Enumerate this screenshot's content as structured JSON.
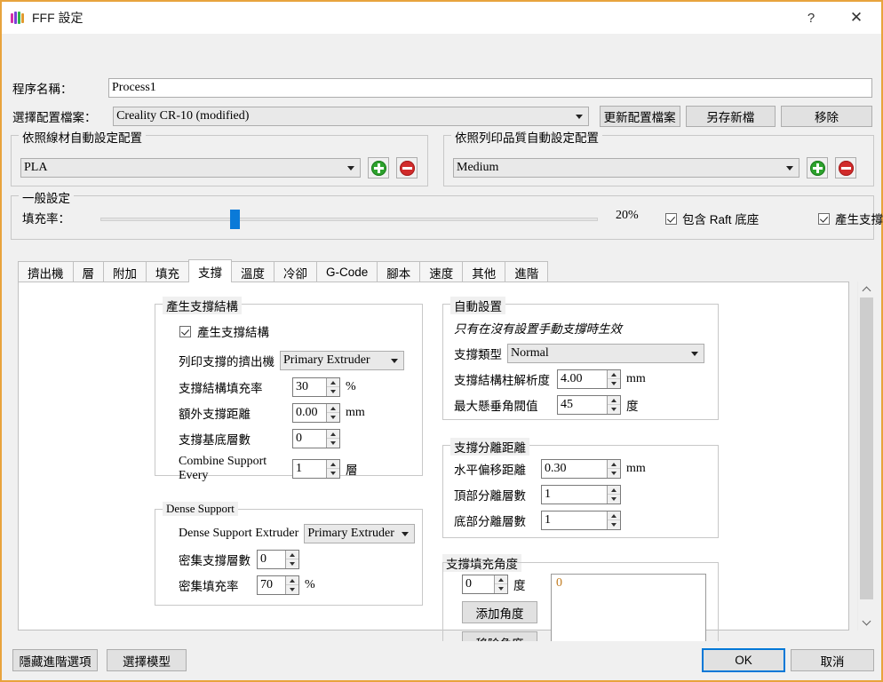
{
  "window": {
    "title": "FFF 設定",
    "icon": "app-logo-icon",
    "help_label": "?",
    "close_label": "✕",
    "accent_color": "#e8a33d"
  },
  "header": {
    "process_name_label": "程序名稱：",
    "process_name_value": "Process1",
    "profile_label": "選擇配置檔案：",
    "profile_value": "Creality CR-10 (modified)",
    "update_profile_button": "更新配置檔案",
    "save_as_button": "另存新檔",
    "remove_button": "移除"
  },
  "material_group": {
    "title": "依照線材自動設定配置",
    "value": "PLA",
    "add_button": "add-icon",
    "remove_button": "remove-icon"
  },
  "quality_group": {
    "title": "依照列印品質自動設定配置",
    "value": "Medium",
    "add_button": "add-icon",
    "remove_button": "remove-icon"
  },
  "general_group": {
    "title": "一般設定",
    "infill_label": "填充率：",
    "infill_value": "20%",
    "infill_percent": 20,
    "raft_checkbox_label": "包含 Raft 底座",
    "raft_checked": true,
    "support_checkbox_label": "產生支撐",
    "support_checked": true
  },
  "tabs": [
    {
      "label": "擠出機",
      "active": false
    },
    {
      "label": "層",
      "active": false
    },
    {
      "label": "附加",
      "active": false
    },
    {
      "label": "填充",
      "active": false
    },
    {
      "label": "支撐",
      "active": true
    },
    {
      "label": "溫度",
      "active": false
    },
    {
      "label": "冷卻",
      "active": false
    },
    {
      "label": "G-Code",
      "active": false
    },
    {
      "label": "腳本",
      "active": false
    },
    {
      "label": "速度",
      "active": false
    },
    {
      "label": "其他",
      "active": false
    },
    {
      "label": "進階",
      "active": false
    }
  ],
  "support_structure_group": {
    "title": "產生支撐結構",
    "enable_label": "產生支撐結構",
    "enable_checked": true,
    "extruder_label": "列印支撐的擠出機",
    "extruder_value": "Primary Extruder",
    "infill_label": "支撐結構填充率",
    "infill_value": "30",
    "infill_unit": "%",
    "extra_distance_label": "額外支撐距離",
    "extra_distance_value": "0.00",
    "extra_distance_unit": "mm",
    "base_layers_label": "支撐基底層數",
    "base_layers_value": "0",
    "combine_label": "Combine Support Every",
    "combine_value": "1",
    "combine_unit": "層"
  },
  "dense_support_group": {
    "title": "Dense Support",
    "extruder_label": "Dense Support Extruder",
    "extruder_value": "Primary Extruder",
    "layers_label": "密集支撐層數",
    "layers_value": "0",
    "infill_label": "密集填充率",
    "infill_value": "70",
    "infill_unit": "%"
  },
  "auto_settings_group": {
    "title": "自動設置",
    "note": "只有在沒有設置手動支撐時生效",
    "type_label": "支撐類型",
    "type_value": "Normal",
    "pillar_label": "支撐結構柱解析度",
    "pillar_value": "4.00",
    "pillar_unit": "mm",
    "overhang_label": "最大懸垂角閥值",
    "overhang_value": "45",
    "overhang_unit": "度"
  },
  "separation_group": {
    "title": "支撐分離距離",
    "horizontal_label": "水平偏移距離",
    "horizontal_value": "0.30",
    "horizontal_unit": "mm",
    "top_label": "頂部分離層數",
    "top_value": "1",
    "bottom_label": "底部分離層數",
    "bottom_value": "1"
  },
  "infill_angles_group": {
    "title": "支撐填充角度",
    "angle_value": "0",
    "angle_unit": "度",
    "add_angle_button": "添加角度",
    "remove_angle_button": "移除角度",
    "angles": [
      "0"
    ]
  },
  "footer": {
    "hide_advanced_button": "隱藏進階選項",
    "select_models_button": "選擇模型",
    "ok_button": "OK",
    "cancel_button": "取消"
  }
}
